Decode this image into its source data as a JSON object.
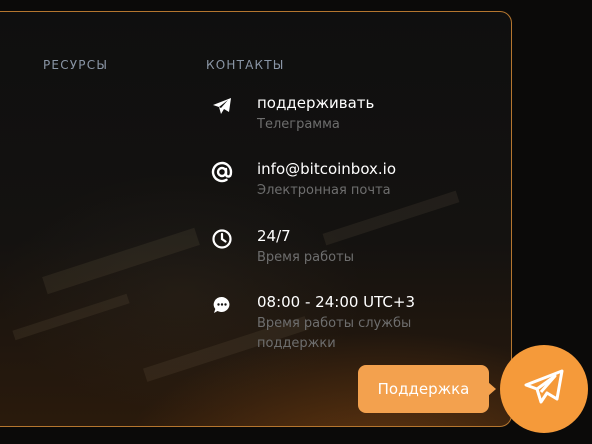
{
  "footer": {
    "resources_title": "РЕСУРСЫ",
    "contacts_title": "КОНТАКТЫ",
    "contacts": [
      {
        "icon": "telegram-icon",
        "value": "поддерживать",
        "label": "Телеграмма"
      },
      {
        "icon": "at-icon",
        "value": "info@bitcoinbox.io",
        "label": "Электронная почта"
      },
      {
        "icon": "clock-icon",
        "value": "24/7",
        "label": "Время работы"
      },
      {
        "icon": "chat-icon",
        "value": "08:00 - 24:00 UTC+3",
        "label": "Время работы службы поддержки"
      }
    ]
  },
  "support_widget": {
    "label": "Поддержка",
    "icon": "telegram-icon"
  },
  "colors": {
    "accent": "#f3a14e",
    "border": "#b5762f",
    "muted_text": "#6e6e6e",
    "heading_text": "#8a96a6"
  }
}
